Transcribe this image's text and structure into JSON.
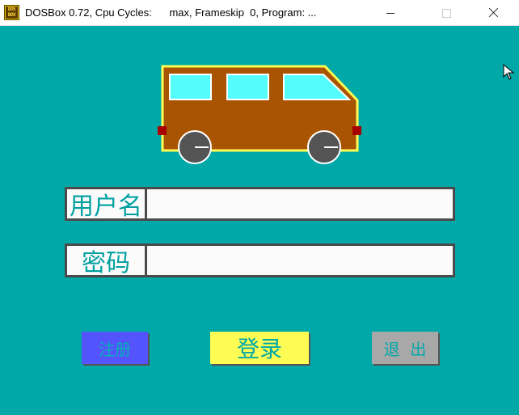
{
  "window": {
    "title": "DOSBox 0.72, Cpu Cycles:      max, Frameskip  0, Program: ...",
    "icon_text": "DOS BOX"
  },
  "illustration": {
    "name": "van-icon",
    "colors": {
      "body": "#a85400",
      "outline": "#fcfc54",
      "windows": "#54fcfc",
      "wheels": "#545454",
      "lights": "#a80000"
    }
  },
  "form": {
    "username_label": "用户名",
    "username_value": "",
    "password_label": "密码",
    "password_value": ""
  },
  "buttons": {
    "register": "注册",
    "login": "登录",
    "exit": "退  出"
  },
  "colors": {
    "background": "#00a8a8",
    "register_bg": "#5454fc",
    "login_bg": "#fcfc54",
    "exit_bg": "#a8a8a8"
  }
}
